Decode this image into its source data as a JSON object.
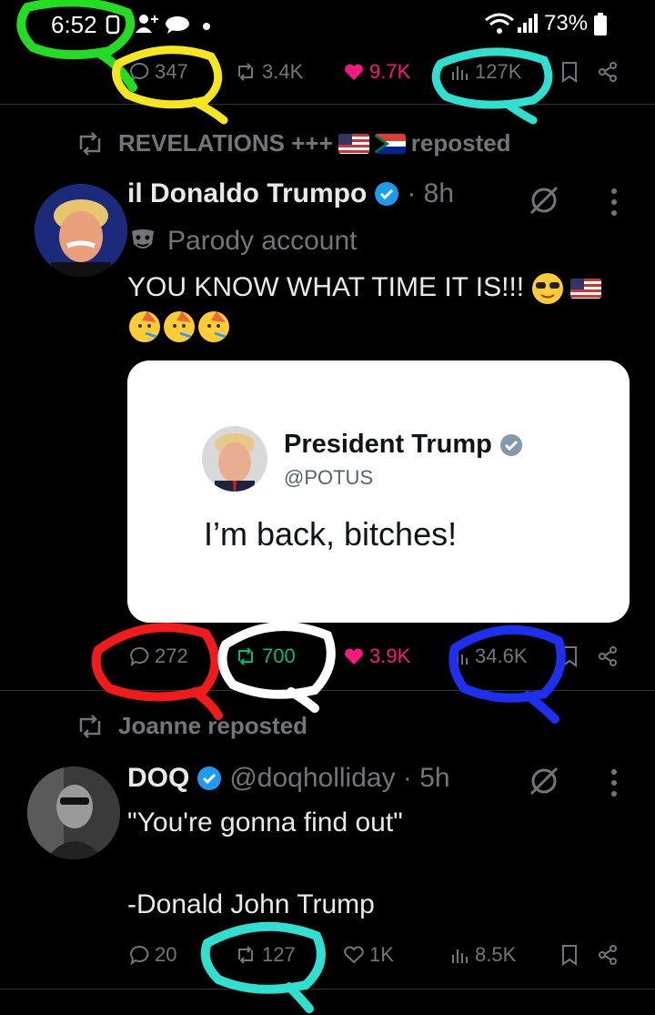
{
  "status_bar": {
    "time": "6:52",
    "battery": "73%",
    "icons": [
      "notification-icon",
      "person-add-icon",
      "message-icon",
      "dot-icon",
      "wifi-icon",
      "signal-icon",
      "battery-icon"
    ]
  },
  "top_stats": {
    "replies": "347",
    "reposts": "3.4K",
    "likes": "9.7K",
    "views": "127K"
  },
  "post1": {
    "reposted_by": "REVELATIONS +++",
    "reposted_suffix": "reposted",
    "author_name": "il Donaldo Trumpo",
    "time": "· 8h",
    "parody_label": "Parody account",
    "text": "YOU KNOW WHAT TIME IT IS!!!",
    "embedded": {
      "name": "President Trump",
      "handle": "@POTUS",
      "text": "I’m back, bitches!"
    },
    "stats": {
      "replies": "272",
      "reposts": "700",
      "likes": "3.9K",
      "views": "34.6K"
    }
  },
  "post2": {
    "reposted_by": "Joanne reposted",
    "author_name": "DOQ",
    "handle_time": "@doqholliday · 5h",
    "text_line1": "\"You're gonna find out\"",
    "text_line2": "-Donald John Trump",
    "stats": {
      "replies": "20",
      "reposts": "127",
      "likes": "1K",
      "views": "8.5K"
    }
  },
  "colors": {
    "background": "#000000",
    "muted": "#71767b",
    "like_pink": "#f91880",
    "repost_green": "#00ba7c",
    "verified_blue": "#1d9bf0"
  }
}
